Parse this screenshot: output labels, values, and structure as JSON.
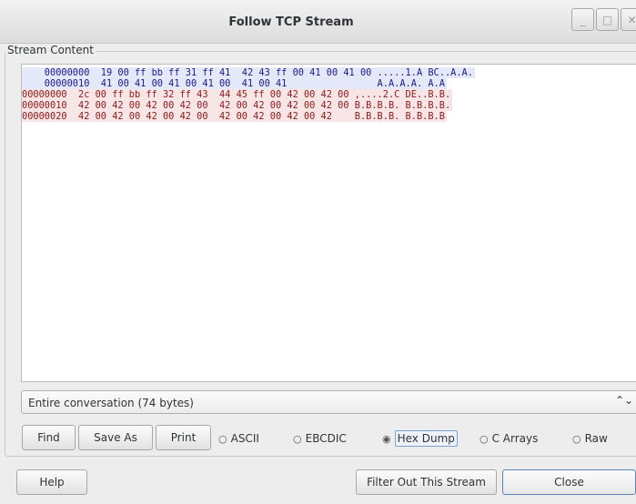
{
  "window": {
    "title": "Follow TCP Stream",
    "minimize_glyph": "_",
    "maximize_glyph": "□",
    "close_glyph": "✕"
  },
  "stream": {
    "label": "Stream Content",
    "lines": [
      "    00000000  19 00 ff bb ff 31 ff 41  42 43 ff 00 41 00 41 00 .....1.A BC..A.A.",
      "    00000010  41 00 41 00 41 00 41 00  41 00 41                A.A.A.A. A.A",
      "00000000  2c 00 ff bb ff 32 ff 43  44 45 ff 00 42 00 42 00 ,....2.C DE..B.B.",
      "00000010  42 00 42 00 42 00 42 00  42 00 42 00 42 00 42 00 B.B.B.B. B.B.B.B.",
      "00000020  42 00 42 00 42 00 42 00  42 00 42 00 42 00 42    B.B.B.B. B.B.B.B"
    ]
  },
  "conversation_select": {
    "value": "Entire conversation (74 bytes)",
    "icon_glyph": "⌃⌄"
  },
  "buttons": {
    "find": "Find",
    "save_as": "Save As",
    "print": "Print",
    "help": "Help",
    "filter_out": "Filter Out This Stream",
    "close": "Close"
  },
  "formats": {
    "selected": "Hex Dump",
    "ascii": "ASCII",
    "ebcdic": "EBCDIC",
    "hex_dump": "Hex Dump",
    "c_arrays": "C Arrays",
    "raw": "Raw"
  },
  "colors": {
    "client_text": "#1a1a8c",
    "client_bg": "#e5e8f8",
    "server_text": "#8c1a1a",
    "server_bg": "#f8e6e6"
  }
}
